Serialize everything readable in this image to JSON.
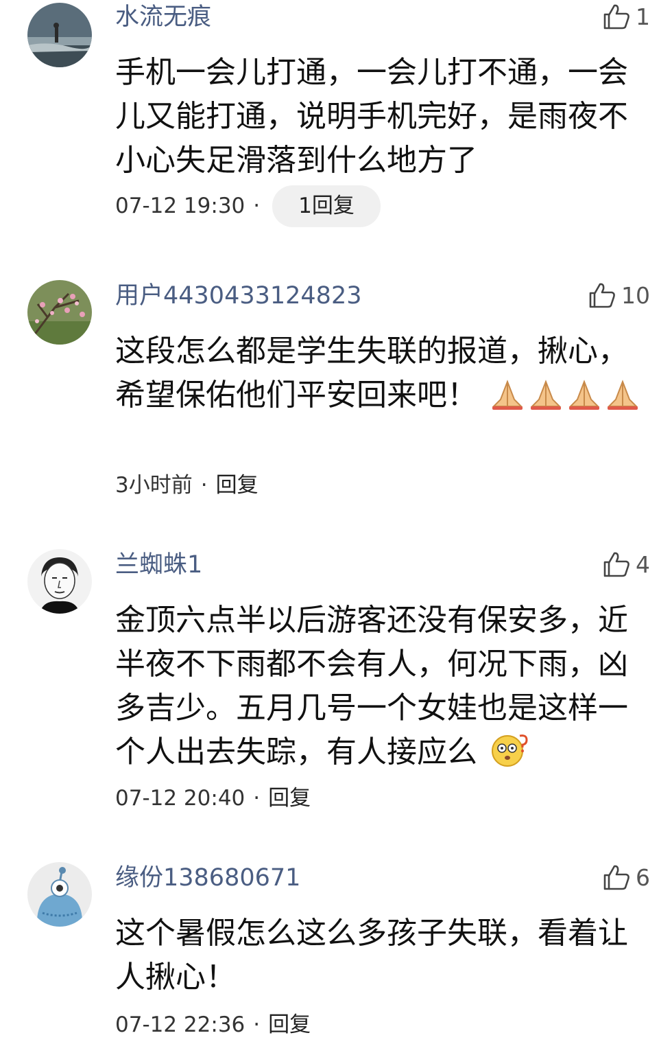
{
  "comments": [
    {
      "username": "水流无痕",
      "likes": "1",
      "text": "手机一会儿打通，一会儿打不通，一会儿又能打通，说明手机完好，是雨夜不小心失足滑落到什么地方了",
      "time": "07-12 19:30",
      "reply": "1回复",
      "avatar": "beach-person-photo"
    },
    {
      "username": "用户4430433124823",
      "likes": "10",
      "text": "这段怎么都是学生失联的报道，揪心，希望保佑他们平安回来吧！",
      "emojis": [
        "pray-emoji",
        "pray-emoji",
        "pray-emoji",
        "pray-emoji"
      ],
      "time": "3小时前",
      "reply": "回复",
      "avatar": "peach-blossom-photo"
    },
    {
      "username": "兰蜘蛛1",
      "likes": "4",
      "text": "金顶六点半以后游客还没有保安多，近半夜不下雨都不会有人，何况下雨，凶多吉少。五月几号一个女娃也是这样一个人出去失踪，有人接应么",
      "emojis": [
        "confused-face-emoji"
      ],
      "time": "07-12 20:40",
      "reply": "回复",
      "avatar": "sketch-portrait"
    },
    {
      "username": "缘份138680671",
      "likes": "6",
      "text": "这个暑假怎么这么多孩子失联，看着让人揪心！",
      "time": "07-12 22:36",
      "reply": "回复",
      "avatar": "cartoon-alien"
    }
  ],
  "separator": "·",
  "colors": {
    "username": "#4a5d82",
    "text": "#111111",
    "meta": "#333333",
    "pill": "#f0f0f0"
  }
}
